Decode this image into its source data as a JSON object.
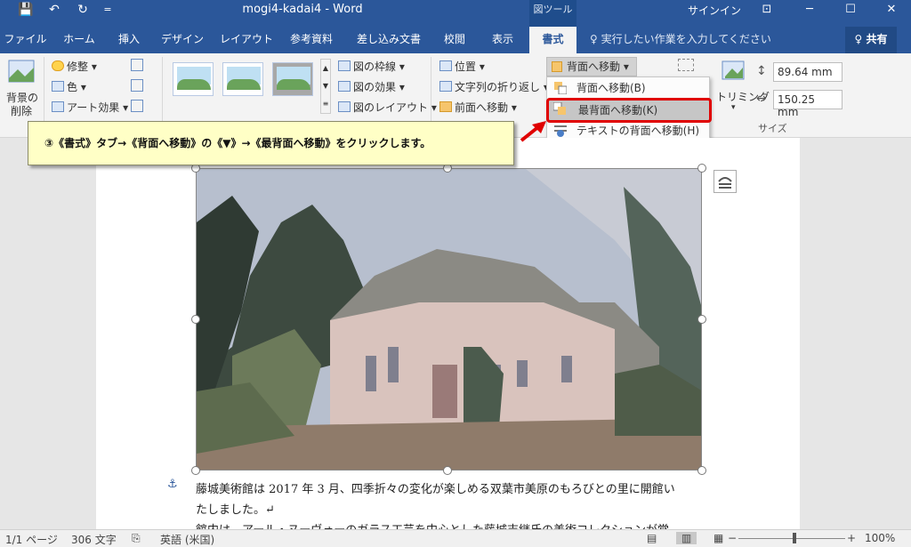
{
  "window": {
    "title": "mogi4-kadai4 - Word",
    "context_label": "図ツール",
    "signin": "サインイン",
    "quick_access": {
      "save": "💾",
      "undo": "↶",
      "redo": "↻",
      "customize": "="
    },
    "controls": {
      "ribbon_display": "⊡",
      "minimize": "─",
      "maximize": "☐",
      "close": "✕"
    }
  },
  "tabs": [
    {
      "label": "ファイル"
    },
    {
      "label": "ホーム"
    },
    {
      "label": "挿入"
    },
    {
      "label": "デザイン"
    },
    {
      "label": "レイアウト"
    },
    {
      "label": "参考資料"
    },
    {
      "label": "差し込み文書"
    },
    {
      "label": "校閲"
    },
    {
      "label": "表示"
    },
    {
      "label": "書式"
    }
  ],
  "tellme": "♀ 実行したい作業を入力してください",
  "share": "♀ 共有",
  "ribbon": {
    "remove_bg_1": "背景の",
    "remove_bg_2": "削除",
    "corrections": "修整 ▾",
    "color": "色 ▾",
    "artistic": "アート効果 ▾",
    "border": "図の枠線 ▾",
    "effects": "図の効果 ▾",
    "layout": "図のレイアウト ▾",
    "position": "位置 ▾",
    "wrap": "文字列の折り返し ▾",
    "bring_forward": "前面へ移動 ▾",
    "send_backward": "背面へ移動 ▾",
    "crop": "トリミング",
    "crop_arrow": "▾",
    "height": "89.64 mm",
    "width": "150.25 mm",
    "size_group": "サイズ"
  },
  "dropdown": {
    "items": [
      {
        "label": "背面へ移動(B)"
      },
      {
        "label": "最背面へ移動(K)"
      },
      {
        "label": "テキストの背面へ移動(H)"
      }
    ]
  },
  "callout": "③《書式》タブ→《背面へ移動》の《▼》→《最背面へ移動》をクリックします。",
  "document": {
    "line1": "藤城美術館は 2017 年 3 月、四季折々の変化が楽しめる双葉市美原のもろびとの里に開館い",
    "line2": "たしました。↵",
    "line3": "館内は、アール・ヌーヴォーのガラス工芸を中心とした藤城吉継氏の美術コレクションが常"
  },
  "status": {
    "page": "1/1 ページ",
    "words": "306 文字",
    "language": "英語 (米国)",
    "zoom": "100%",
    "zoom_minus": "−",
    "zoom_plus": "+"
  },
  "colors": {
    "accent": "#2b579a",
    "highlight_border": "#e00000",
    "callout_bg": "#ffffc6"
  }
}
